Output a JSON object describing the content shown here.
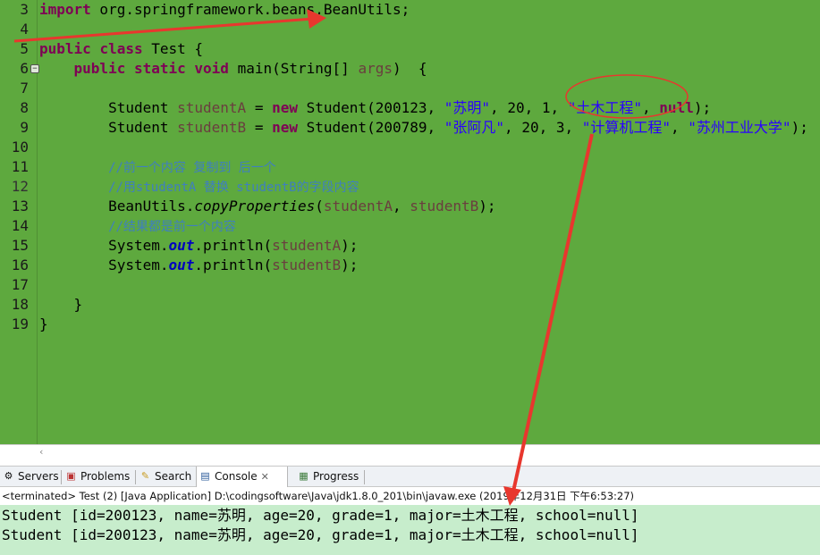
{
  "editor": {
    "line_numbers": [
      "3",
      "4",
      "5",
      "6",
      "7",
      "8",
      "9",
      "10",
      "11",
      "12",
      "13",
      "14",
      "15",
      "16",
      "17",
      "18",
      "19"
    ],
    "code": {
      "l3": {
        "import_kw": "import",
        "path": " org.springframework.beans.BeanUtils;"
      },
      "l5": {
        "kw1": "public",
        "kw2": "class",
        "rest": " Test {"
      },
      "l6": {
        "indent": "    ",
        "kw1": "public",
        "kw2": "static",
        "kw3": "void",
        "name": " main(String[] ",
        "args": "args",
        "end": ")  {"
      },
      "l8": {
        "indent": "        ",
        "type": "Student ",
        "var": "studentA",
        "eq": " = ",
        "new": "new",
        "ctor": " Student(200123, ",
        "s1": "\"苏明\"",
        "mid": ", 20, 1, ",
        "s2": "\"土木工程\"",
        "comma": ", ",
        "null": "null",
        "end": ");"
      },
      "l9": {
        "indent": "        ",
        "type": "Student ",
        "var": "studentB",
        "eq": " = ",
        "new": "new",
        "ctor": " Student(200789, ",
        "s1": "\"张阿凡\"",
        "mid": ", 20, 3, ",
        "s2": "\"计算机工程\"",
        "comma": ", ",
        "s3": "\"苏州工业大学\"",
        "end": ");"
      },
      "l11": {
        "indent": "        ",
        "comment": "//前一个内容 复制到 后一个"
      },
      "l12": {
        "indent": "        ",
        "comment": "//用studentA 替换 studentB的字段内容"
      },
      "l13": {
        "indent": "        ",
        "cls": "BeanUtils.",
        "method": "copyProperties",
        "open": "(",
        "a": "studentA",
        "comma": ", ",
        "b": "studentB",
        "end": ");"
      },
      "l14": {
        "indent": "        ",
        "comment": "//结果都是前一个内容"
      },
      "l15": {
        "indent": "        ",
        "sys": "System.",
        "out": "out",
        "println": ".println(",
        "arg": "studentA",
        "end": ");"
      },
      "l16": {
        "indent": "        ",
        "sys": "System.",
        "out": "out",
        "println": ".println(",
        "arg": "studentB",
        "end": ");"
      },
      "l18": {
        "text": "    }"
      },
      "l19": {
        "text": "}"
      }
    }
  },
  "tabs": [
    {
      "label": "Servers",
      "icon": "servers-icon"
    },
    {
      "label": "Problems",
      "icon": "problems-icon"
    },
    {
      "label": "Search",
      "icon": "search-icon"
    },
    {
      "label": "Console",
      "icon": "console-icon",
      "close": "✕"
    },
    {
      "label": "Progress",
      "icon": "progress-icon"
    }
  ],
  "console": {
    "header": "<terminated> Test (2) [Java Application] D:\\codingsoftware\\Java\\jdk1.8.0_201\\bin\\javaw.exe (2019年12月31日 下午6:53:27)",
    "output": [
      "Student [id=200123, name=苏明, age=20, grade=1, major=土木工程, school=null]",
      "Student [id=200123, name=苏明, age=20, grade=1, major=土木工程, school=null]"
    ]
  },
  "colors": {
    "editor_bg": "#5ea93e",
    "console_bg": "#c7edcc",
    "annotation": "#e8372e"
  }
}
